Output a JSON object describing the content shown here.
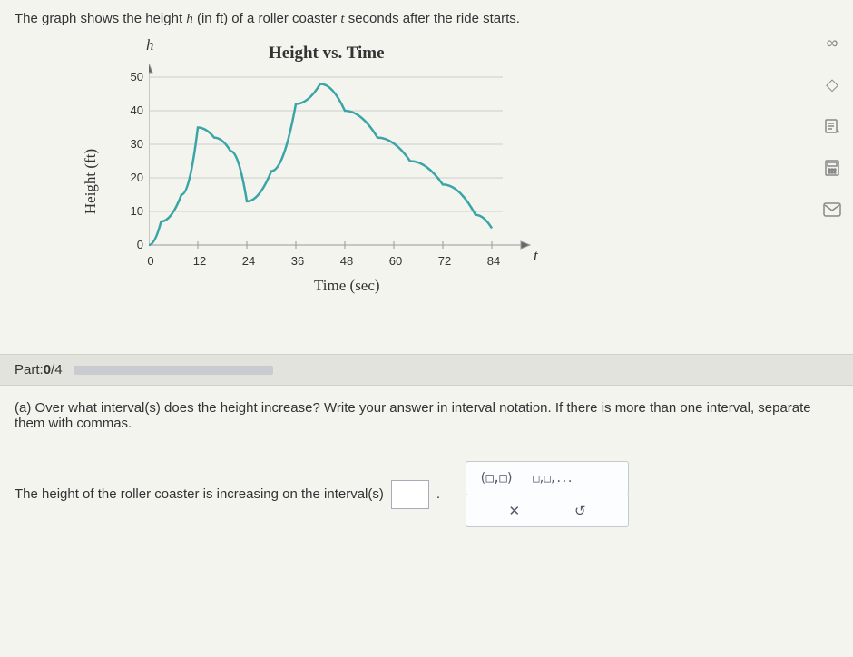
{
  "intro_pre": "The graph shows the height ",
  "intro_var1": "h",
  "intro_mid": " (in ft) of a roller coaster ",
  "intro_var2": "t",
  "intro_post": " seconds after the ride starts.",
  "chart_data": {
    "type": "line",
    "title": "Height vs. Time",
    "xlabel": "Time (sec)",
    "ylabel": "Height (ft)",
    "x_var": "t",
    "y_var": "h",
    "x_ticks": [
      0,
      12,
      24,
      36,
      48,
      60,
      72,
      84
    ],
    "y_ticks": [
      0,
      10,
      20,
      30,
      40,
      50
    ],
    "xlim": [
      0,
      90
    ],
    "ylim": [
      0,
      55
    ],
    "series": [
      {
        "name": "height",
        "x": [
          0,
          3,
          8,
          12,
          16,
          20,
          24,
          30,
          36,
          42,
          48,
          56,
          64,
          72,
          80,
          84
        ],
        "y": [
          0,
          7,
          15,
          35,
          32,
          28,
          13,
          22,
          42,
          48,
          40,
          32,
          25,
          18,
          9,
          5
        ]
      }
    ]
  },
  "part_label_pre": "Part: ",
  "part_current": "0",
  "part_sep": " / ",
  "part_total": "4",
  "question_text": "(a) Over what interval(s) does the height increase? Write your answer in interval notation. If there is more than one interval, separate them with commas.",
  "answer_prompt": "The height of the roller coaster is increasing on the interval(s)",
  "answer_period": ".",
  "palette": {
    "interval": "(□,□)",
    "list": "□,□,...",
    "clear": "✕",
    "undo": "↺"
  },
  "tools": {
    "infinity": "∞",
    "hint": "◇",
    "note": "",
    "calc": "",
    "mail": "✉"
  }
}
